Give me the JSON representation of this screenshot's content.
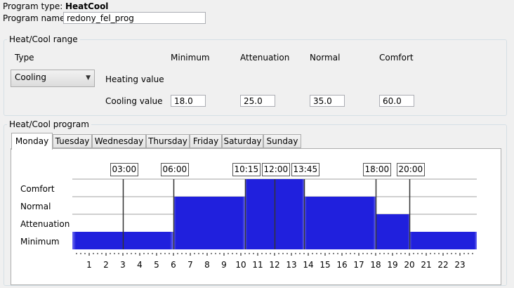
{
  "program": {
    "type_label": "Program type:",
    "type_value": "HeatCool",
    "name_label": "Program name:",
    "name_value": "redony_fel_prog"
  },
  "range": {
    "title": "Heat/Cool range",
    "type_label": "Type",
    "type_value": "Cooling",
    "columns": [
      "Minimum",
      "Attenuation",
      "Normal",
      "Comfort"
    ],
    "heating_label": "Heating value",
    "cooling_label": "Cooling value",
    "cooling_values": [
      "18.0",
      "25.0",
      "35.0",
      "60.0"
    ]
  },
  "program_section": {
    "title": "Heat/Cool program",
    "tabs": [
      "Monday",
      "Tuesday",
      "Wednesday",
      "Thursday",
      "Friday",
      "Saturday",
      "Sunday"
    ],
    "active_tab": 0
  },
  "colors": {
    "fill": "#2020dd",
    "fill_edge": "#7070f0",
    "grid": "#a0a0a0",
    "marker": "#333333"
  },
  "chart_data": {
    "type": "area",
    "levels": [
      "Minimum",
      "Attenuation",
      "Normal",
      "Comfort"
    ],
    "x_ticks": [
      "1",
      "2",
      "3",
      "4",
      "5",
      "6",
      "7",
      "8",
      "9",
      "10",
      "11",
      "12",
      "13",
      "14",
      "15",
      "16",
      "17",
      "18",
      "19",
      "20",
      "21",
      "22",
      "23"
    ],
    "xlim": [
      0,
      24
    ],
    "segments": [
      {
        "start": 0.0,
        "end": 6.0,
        "level": "Minimum"
      },
      {
        "start": 6.0,
        "end": 10.25,
        "level": "Normal"
      },
      {
        "start": 10.25,
        "end": 13.75,
        "level": "Comfort"
      },
      {
        "start": 13.75,
        "end": 18.0,
        "level": "Normal"
      },
      {
        "start": 18.0,
        "end": 20.0,
        "level": "Attenuation"
      },
      {
        "start": 20.0,
        "end": 24.0,
        "level": "Minimum"
      }
    ],
    "markers": [
      {
        "time": 3.0,
        "label": "03:00"
      },
      {
        "time": 6.0,
        "label": "06:00"
      },
      {
        "time": 10.25,
        "label": "10:15"
      },
      {
        "time": 12.0,
        "label": "12:00"
      },
      {
        "time": 13.75,
        "label": "13:45"
      },
      {
        "time": 18.0,
        "label": "18:00"
      },
      {
        "time": 20.0,
        "label": "20:00"
      }
    ]
  }
}
